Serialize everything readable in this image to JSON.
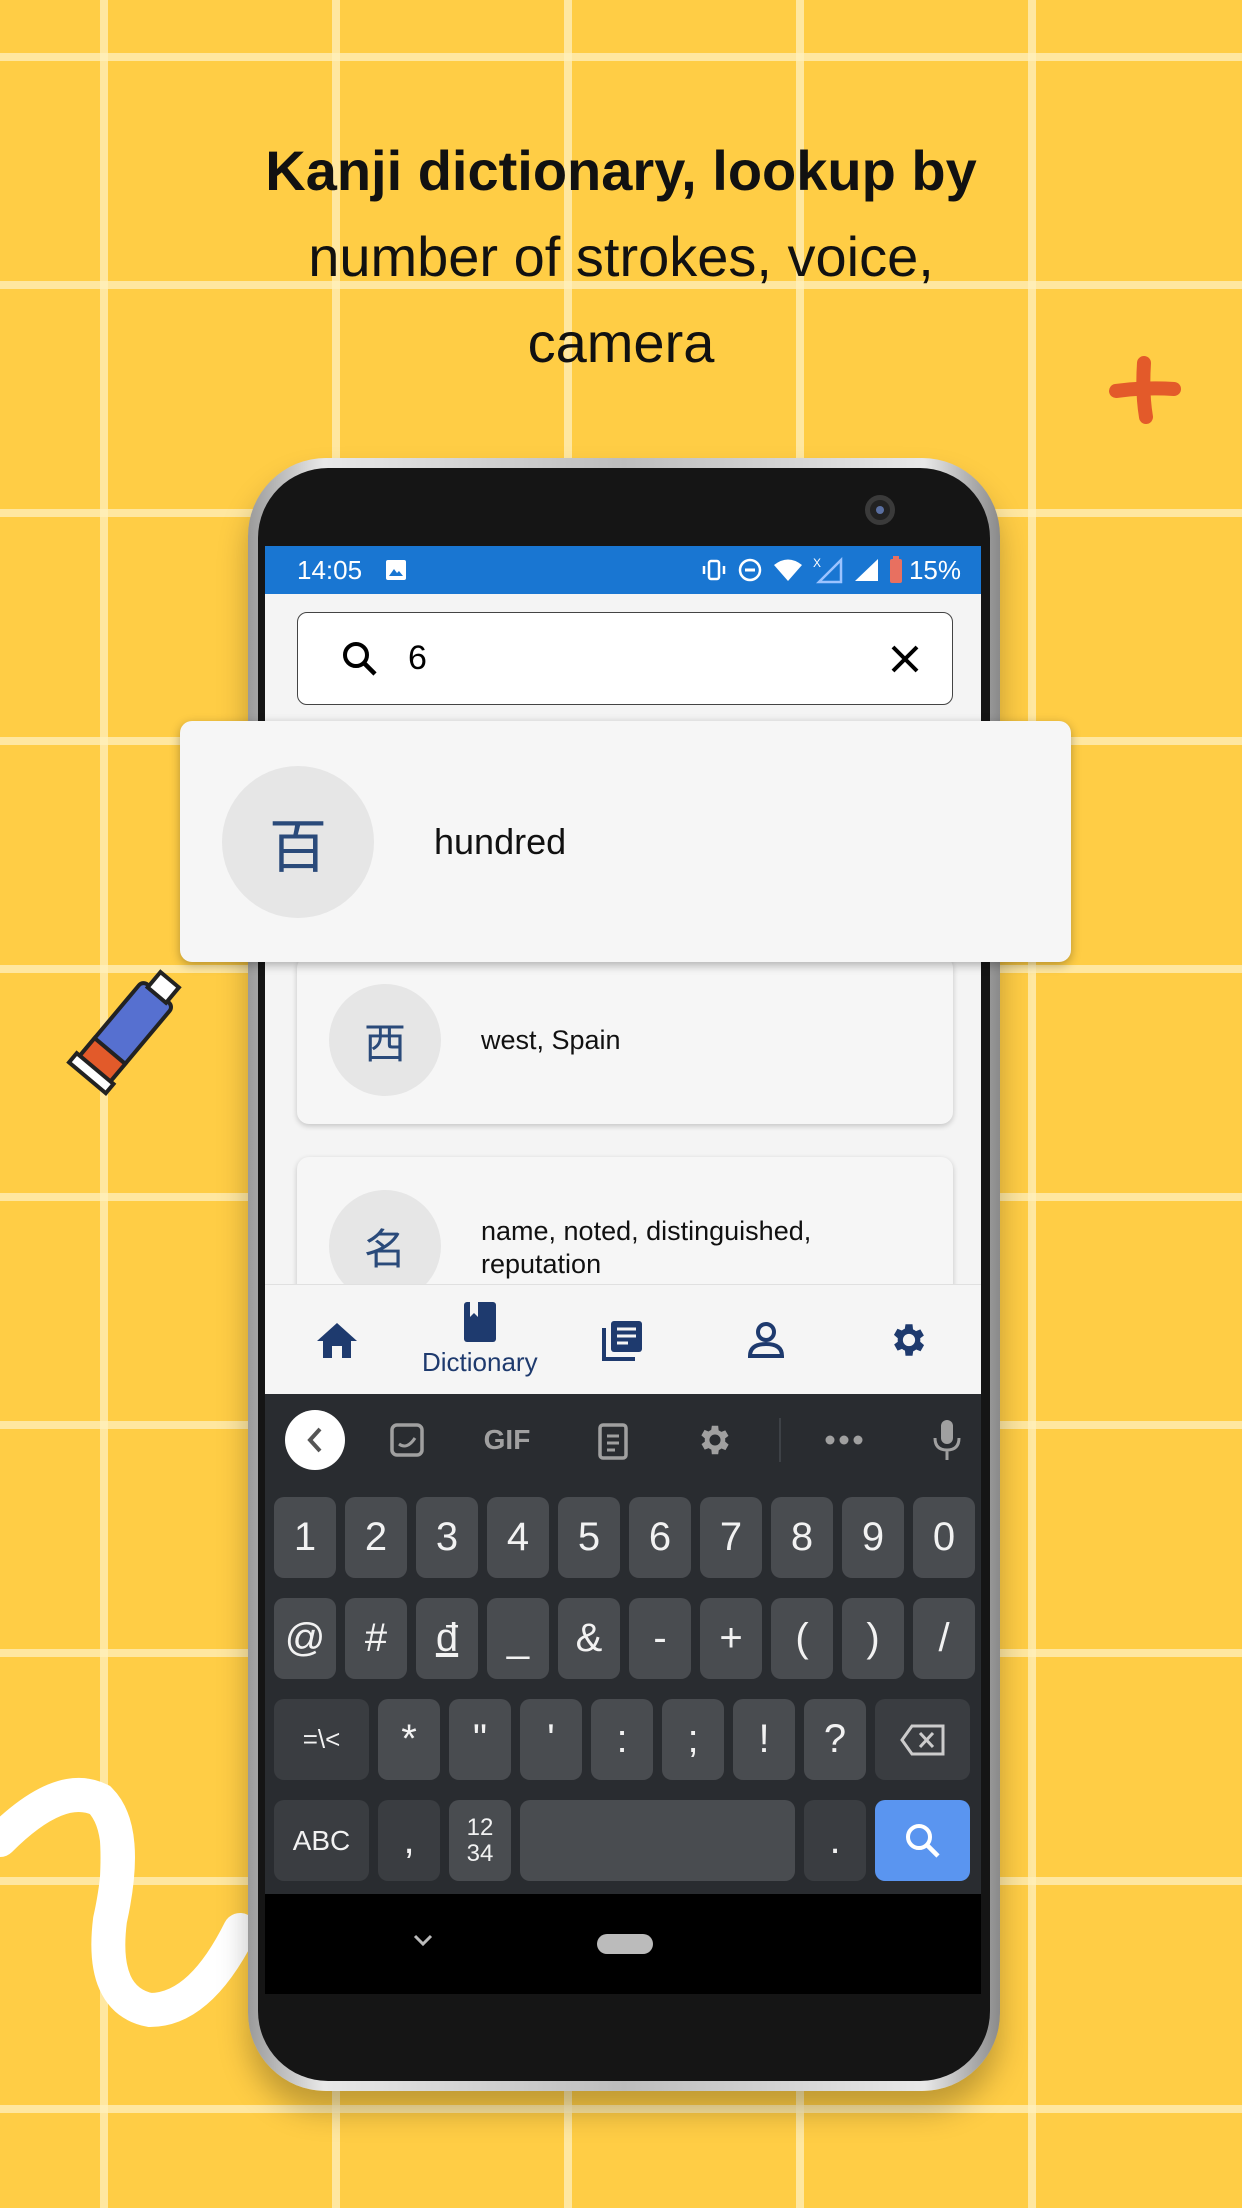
{
  "headline": {
    "bold": "Kanji dictionary, lookup by",
    "rest": "number of strokes, voice, camera"
  },
  "status_bar": {
    "time": "14:05",
    "battery": "15%"
  },
  "search": {
    "value": "6"
  },
  "results": [
    {
      "kanji": "百",
      "meaning": "hundred"
    },
    {
      "kanji": "西",
      "meaning": "west, Spain"
    },
    {
      "kanji": "名",
      "meaning": "name, noted, distinguished, reputation"
    }
  ],
  "bottom_nav": {
    "active": "Dictionary",
    "items": [
      "home-icon",
      "dictionary-icon",
      "news-icon",
      "profile-icon",
      "settings-icon"
    ],
    "dictionary_label": "Dictionary"
  },
  "keyboard": {
    "toolbar": {
      "gif": "GIF"
    },
    "row1": [
      "1",
      "2",
      "3",
      "4",
      "5",
      "6",
      "7",
      "8",
      "9",
      "0"
    ],
    "row2": [
      "@",
      "#",
      "đ",
      "_",
      "&",
      "-",
      "+",
      "(",
      ")",
      "/"
    ],
    "row3": [
      "=\\<",
      "*",
      "\"",
      "'",
      ":",
      ";",
      "!",
      "?"
    ],
    "row4": {
      "abc": "ABC",
      "comma": ",",
      "numpad_top": "12",
      "numpad_bottom": "34",
      "period": "."
    }
  },
  "colors": {
    "background": "#FFCD45",
    "status_bar": "#1976D2",
    "nav_accent": "#1E3A6E",
    "search_key": "#5A95F0",
    "keyboard": "#292C30"
  }
}
